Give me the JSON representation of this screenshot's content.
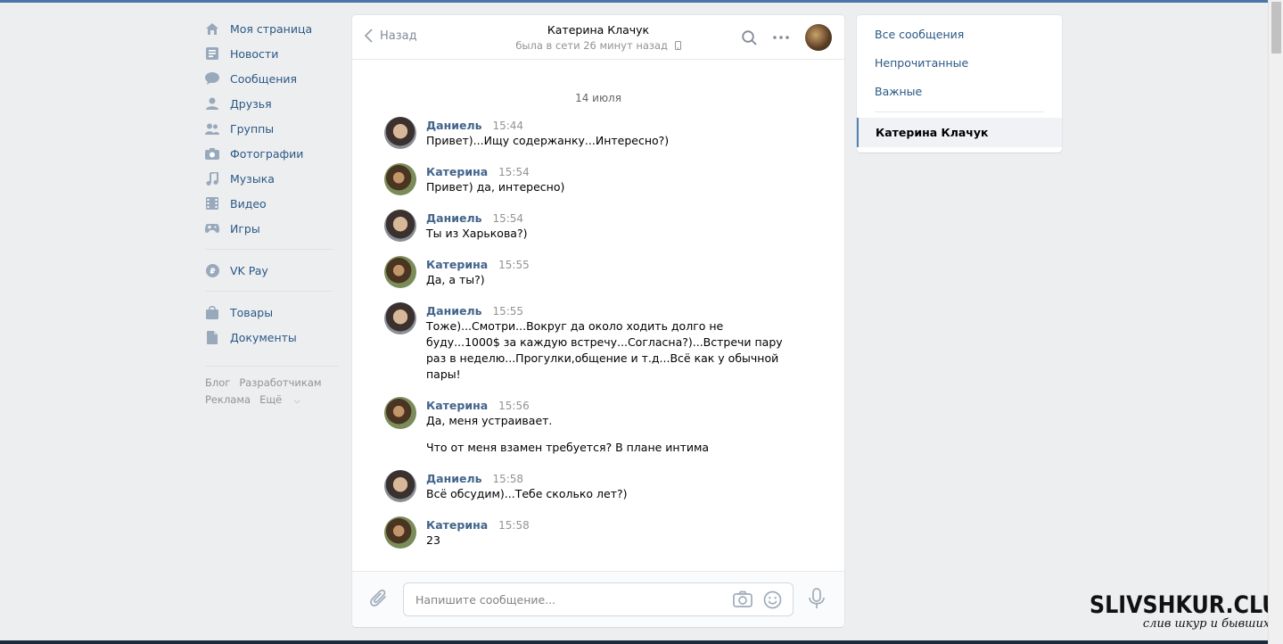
{
  "left_nav": {
    "items": [
      {
        "label": "Моя страница",
        "icon": "home-icon"
      },
      {
        "label": "Новости",
        "icon": "news-icon"
      },
      {
        "label": "Сообщения",
        "icon": "messages-icon"
      },
      {
        "label": "Друзья",
        "icon": "friends-icon"
      },
      {
        "label": "Группы",
        "icon": "groups-icon"
      },
      {
        "label": "Фотографии",
        "icon": "camera-icon"
      },
      {
        "label": "Музыка",
        "icon": "music-icon"
      },
      {
        "label": "Видео",
        "icon": "video-icon"
      },
      {
        "label": "Игры",
        "icon": "games-icon"
      }
    ],
    "pay": {
      "label": "VK Pay",
      "icon": "ruble-icon"
    },
    "extra": [
      {
        "label": "Товары",
        "icon": "bag-icon"
      },
      {
        "label": "Документы",
        "icon": "document-icon"
      }
    ],
    "footer": {
      "blog": "Блог",
      "devs": "Разработчикам",
      "ads": "Реклама",
      "more": "Ещё"
    }
  },
  "chat": {
    "back_label": "Назад",
    "peer_name": "Катерина Клачук",
    "peer_status": "была в сети 26 минут назад",
    "date": "14 июля",
    "messages": [
      {
        "author": "Даниель",
        "time": "15:44",
        "lines": [
          "Привет)...Ищу содержанку...Интересно?)"
        ]
      },
      {
        "author": "Катерина",
        "time": "15:54",
        "lines": [
          "Привет) да, интересно)"
        ]
      },
      {
        "author": "Даниель",
        "time": "15:54",
        "lines": [
          "Ты из Харькова?)"
        ]
      },
      {
        "author": "Катерина",
        "time": "15:55",
        "lines": [
          "Да, а ты?)"
        ]
      },
      {
        "author": "Даниель",
        "time": "15:55",
        "lines": [
          "Тоже)...Смотри...Вокруг да около ходить долго не буду...1000$ за каждую встречу...Согласна?)...Встречи пару раз в неделю...Прогулки,общение и т.д...Всё как у обычной пары!"
        ]
      },
      {
        "author": "Катерина",
        "time": "15:56",
        "lines": [
          "Да, меня устраивает.",
          "Что от меня взамен требуется? В плане интима"
        ]
      },
      {
        "author": "Даниель",
        "time": "15:58",
        "lines": [
          "Всё обсудим)...Тебе сколько лет?)"
        ]
      },
      {
        "author": "Катерина",
        "time": "15:58",
        "lines": [
          "23"
        ]
      }
    ],
    "composer_placeholder": "Напишите сообщение..."
  },
  "right_panel": {
    "all": "Все сообщения",
    "unread": "Непрочитанные",
    "important": "Важные",
    "active_chat": "Катерина Клачук"
  },
  "watermark": {
    "title": "SLIVSHKUR.CLUB",
    "subtitle": "слив шкур и бывших"
  },
  "colors": {
    "accent": "#4a76a8",
    "link": "#2a5885",
    "author": "#42648b"
  }
}
